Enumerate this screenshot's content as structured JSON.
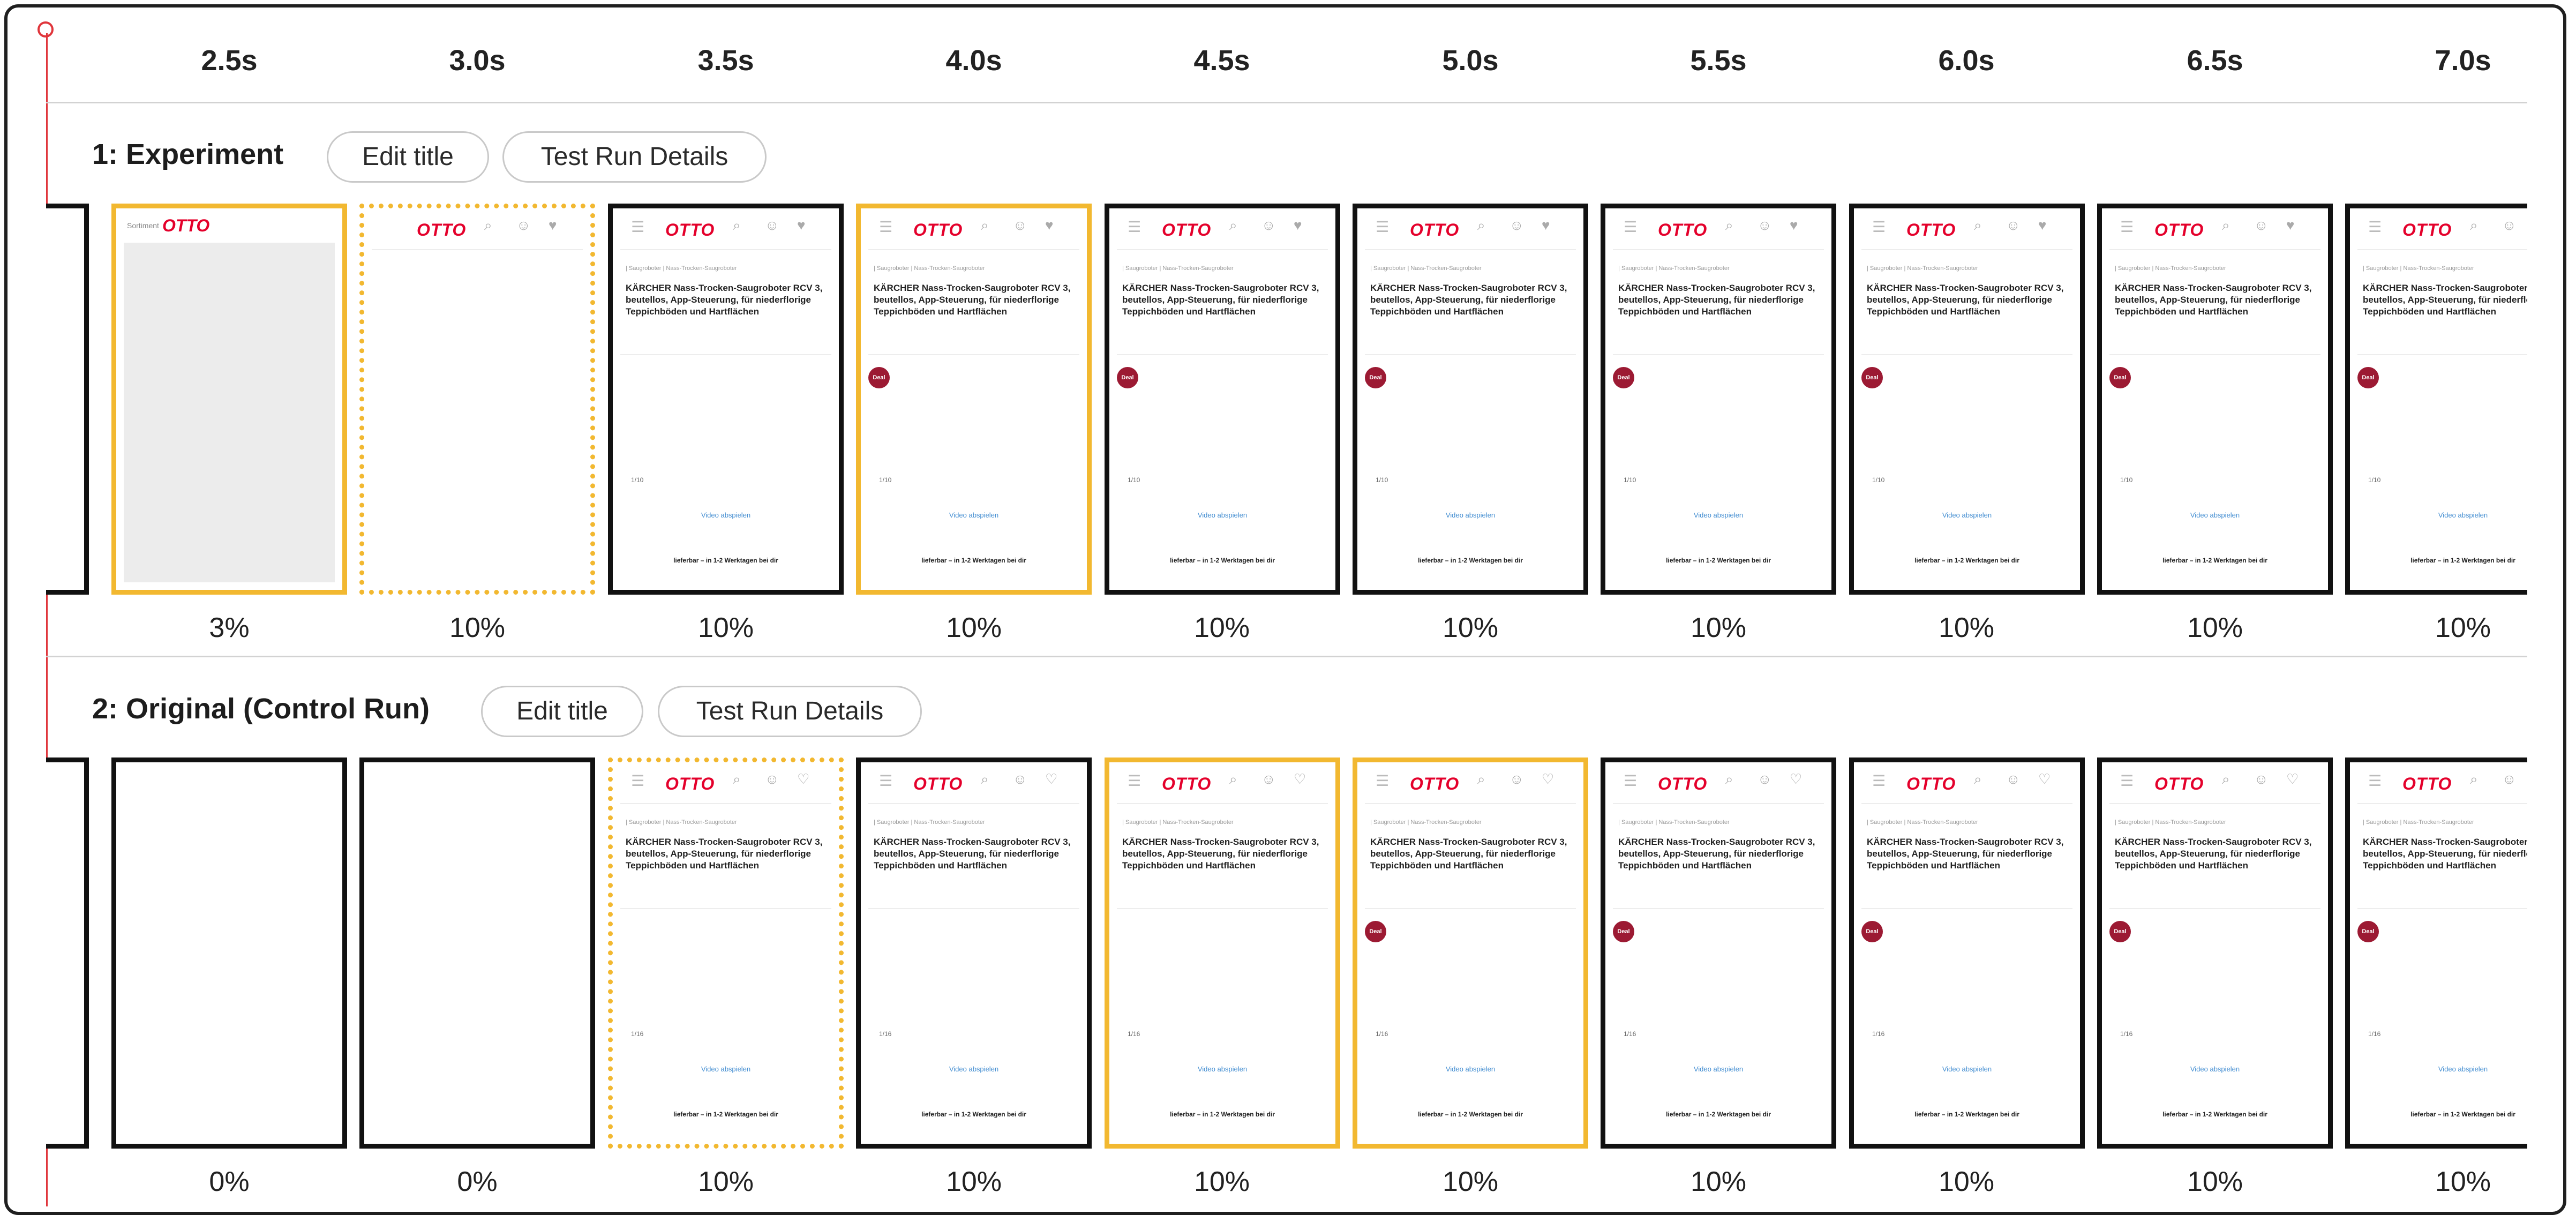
{
  "timeline": {
    "ticks": [
      "2.5s",
      "3.0s",
      "3.5s",
      "4.0s",
      "4.5s",
      "5.0s",
      "5.5s",
      "6.0s",
      "6.5s",
      "7.0s"
    ]
  },
  "rows": [
    {
      "title": "1: Experiment",
      "edit_label": "Edit title",
      "details_label": "Test Run Details",
      "percents": [
        "3%",
        "10%",
        "10%",
        "10%",
        "10%",
        "10%",
        "10%",
        "10%",
        "10%",
        "10%"
      ]
    },
    {
      "title": "2: Original (Control Run)",
      "edit_label": "Edit title",
      "details_label": "Test Run Details",
      "percents": [
        "0%",
        "0%",
        "10%",
        "10%",
        "10%",
        "10%",
        "10%",
        "10%",
        "10%",
        "10%"
      ]
    }
  ],
  "page_thumb": {
    "logo": "OTTO",
    "loading_label": "Sortiment",
    "breadcrumb": "| Saugroboter | Nass-Trocken-Saugroboter",
    "product_title": "KÄRCHER Nass-Trocken-Saugroboter RCV 3, beutellos, App-Steuerung, für niederflorige Teppichböden und Hartflächen",
    "deal_badge": "Deal",
    "image_count_a": "1/10",
    "image_count_b": "1/16",
    "video_link": "Video abspielen",
    "delivery": "lieferbar – in 1-2 Werktagen bei dir"
  },
  "colors": {
    "playhead": "#e0353b",
    "visual_change": "#f2b830",
    "frame_border": "#111111",
    "otto_red": "#e4002b"
  }
}
